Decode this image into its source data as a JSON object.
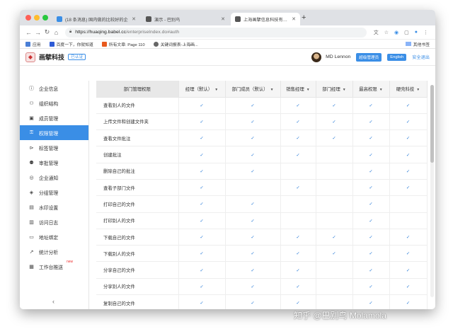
{
  "browser": {
    "tabs": [
      {
        "title": "(18 条消息) 国内做的比较好的企"
      },
      {
        "title": "演示 - 巴别鸟"
      },
      {
        "title": "上海画擘信息科技有限公司 - 企"
      }
    ],
    "url_host": "https://huaqing.babel.cc",
    "url_path": "/enterpriseIndex.do#auth",
    "bookmarks": [
      "应用",
      "百度一下，你就知道",
      "所有文章: Page 110",
      "关键词报表-上海画..."
    ],
    "other_bookmarks": "其他书签"
  },
  "app": {
    "brand": "画擘科技",
    "verified": "已认证",
    "user_name": "MD Lennon",
    "admin_badge": "超级管理员",
    "lang_button": "English",
    "logout": "安全退出"
  },
  "sidebar": {
    "items": [
      {
        "label": "企业信息",
        "icon": "info-icon"
      },
      {
        "label": "组织结构",
        "icon": "org-icon"
      },
      {
        "label": "成员管理",
        "icon": "member-icon"
      },
      {
        "label": "权限管理",
        "icon": "permission-icon"
      },
      {
        "label": "标签管理",
        "icon": "tag-icon"
      },
      {
        "label": "审批管理",
        "icon": "approval-icon"
      },
      {
        "label": "企业通知",
        "icon": "bell-icon"
      },
      {
        "label": "分组管理",
        "icon": "group-icon"
      },
      {
        "label": "水印设置",
        "icon": "watermark-icon"
      },
      {
        "label": "访问日志",
        "icon": "log-icon"
      },
      {
        "label": "地址绑定",
        "icon": "ip-icon"
      },
      {
        "label": "统计分析",
        "icon": "chart-icon"
      },
      {
        "label": "工作台推送",
        "icon": "push-icon"
      }
    ],
    "active_index": 3,
    "new_tag": "new"
  },
  "table": {
    "columns": [
      "部门管理权限",
      "经理（默认）",
      "部门成员（默认）",
      "销售经理",
      "部门经理",
      "最高权限",
      "硬壳科技"
    ],
    "check_glyph": "✓",
    "rows": [
      {
        "label": "查看别人的文件",
        "checks": [
          true,
          true,
          true,
          true,
          true,
          true
        ]
      },
      {
        "label": "上传文件和创建文件夹",
        "checks": [
          true,
          true,
          true,
          true,
          true,
          true
        ]
      },
      {
        "label": "查看文件批注",
        "checks": [
          true,
          true,
          true,
          true,
          true,
          true
        ]
      },
      {
        "label": "创建批注",
        "checks": [
          true,
          true,
          true,
          false,
          true,
          true
        ]
      },
      {
        "label": "删除自己的批注",
        "checks": [
          true,
          true,
          false,
          false,
          true,
          true
        ]
      },
      {
        "label": "查看子部门文件",
        "checks": [
          true,
          false,
          true,
          false,
          true,
          true
        ]
      },
      {
        "label": "打印自己的文件",
        "checks": [
          true,
          true,
          false,
          false,
          true,
          false
        ]
      },
      {
        "label": "打印别人的文件",
        "checks": [
          true,
          true,
          false,
          false,
          true,
          false
        ]
      },
      {
        "label": "下载自己的文件",
        "checks": [
          true,
          true,
          true,
          true,
          true,
          true
        ]
      },
      {
        "label": "下载别人的文件",
        "checks": [
          true,
          true,
          true,
          true,
          true,
          true
        ]
      },
      {
        "label": "分享自己的文件",
        "checks": [
          true,
          true,
          true,
          false,
          true,
          true
        ]
      },
      {
        "label": "分享别人的文件",
        "checks": [
          true,
          true,
          true,
          false,
          true,
          true
        ]
      },
      {
        "label": "复制自己的文件",
        "checks": [
          true,
          true,
          true,
          false,
          true,
          true
        ]
      }
    ]
  },
  "watermark_text": "知乎 @巴别鸟 Molamola"
}
